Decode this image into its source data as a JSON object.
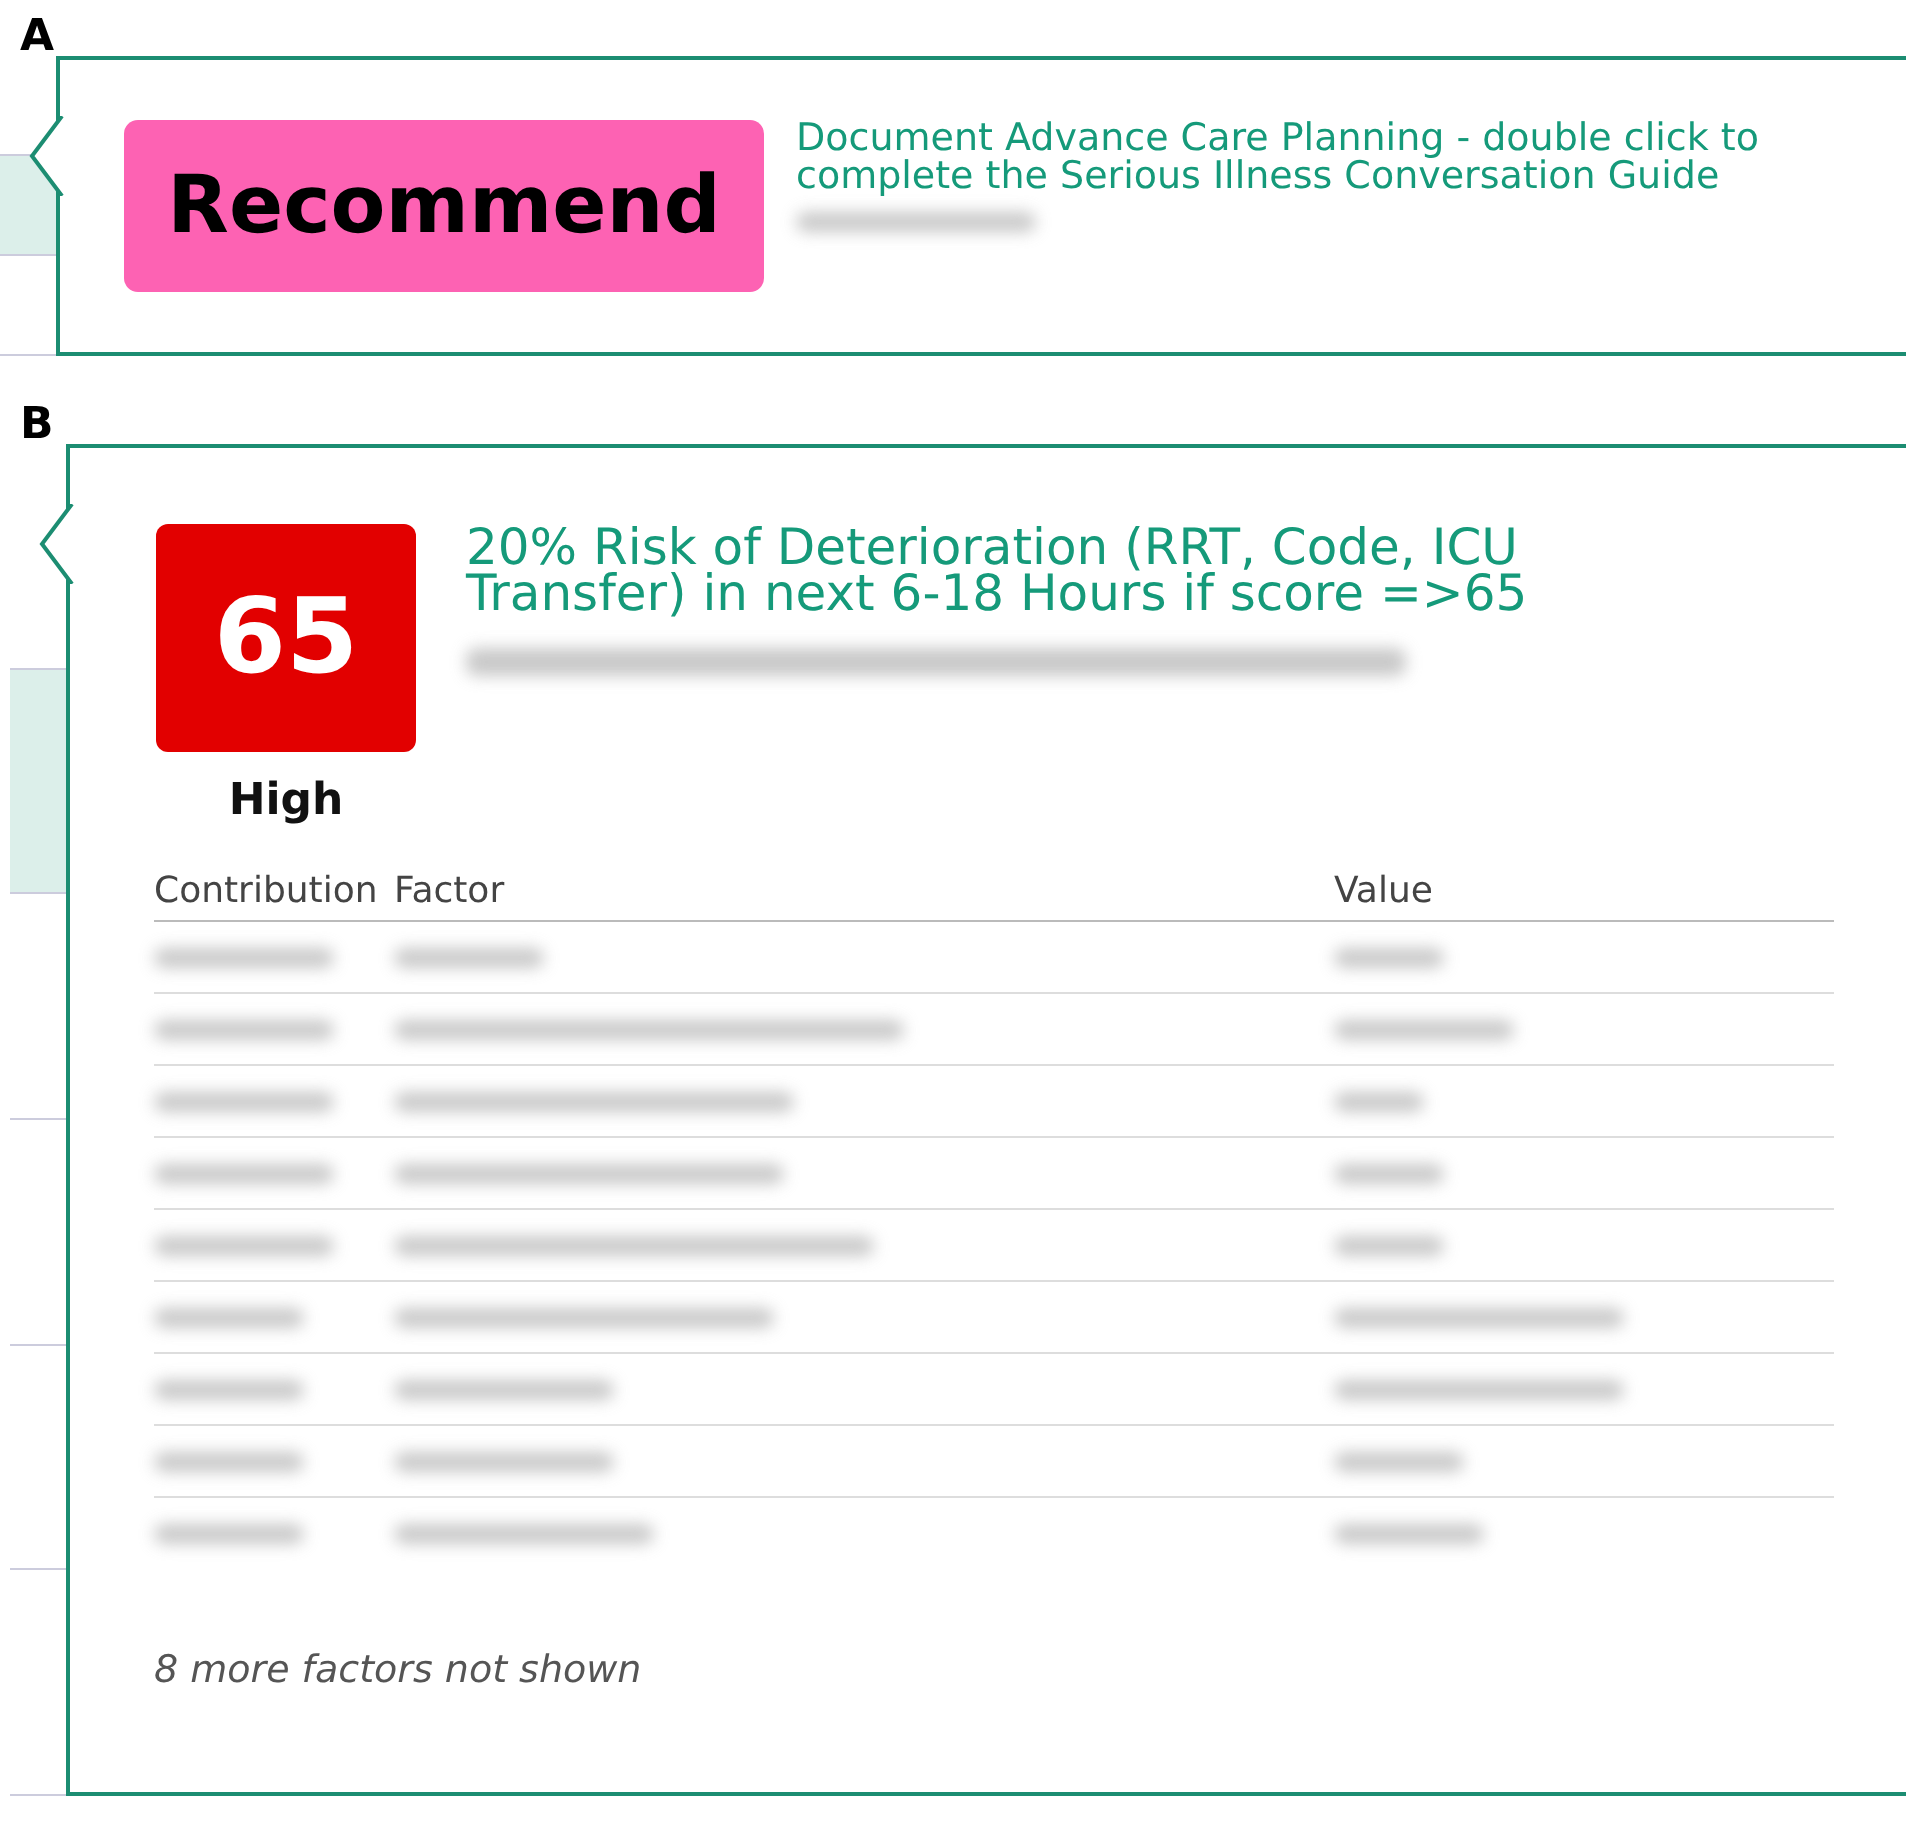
{
  "panel_a": {
    "label": "A",
    "badge": {
      "text": "Recommend",
      "color": "#fd62b3"
    },
    "link": "Document Advance Care Planning - double click to complete the Serious Illness Conversation Guide"
  },
  "panel_b": {
    "label": "B",
    "score": {
      "value": "65",
      "level_text": "High",
      "color": "#e20000"
    },
    "title": "20% Risk of Deterioration (RRT, Code, ICU Transfer) in next 6-18 Hours if score =>65",
    "table": {
      "columns": [
        "Contribution",
        "Factor",
        "Value"
      ]
    },
    "footer": "8 more factors not shown"
  }
}
